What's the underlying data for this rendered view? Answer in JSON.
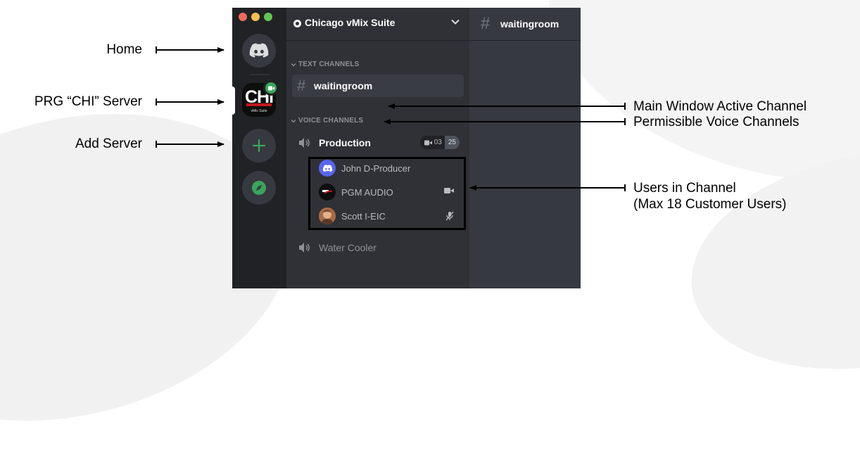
{
  "window": {
    "server_name": "Chicago vMix Suite",
    "active_channel": "waitingroom"
  },
  "server_rail": {
    "chi_logo_text": "CHi",
    "chi_logo_subtext": "vMix Suite"
  },
  "categories": {
    "text": "TEXT CHANNELS",
    "voice": "VOICE CHANNELS"
  },
  "text_channels": [
    {
      "name": "waitingroom",
      "selected": true
    }
  ],
  "voice_channels": [
    {
      "name": "Production",
      "video_count": "03",
      "user_count": "25",
      "users": [
        {
          "name": "John D-Producer",
          "avatar": "discord-avatar-icon",
          "status_icon": ""
        },
        {
          "name": "PGM AUDIO",
          "avatar": "prg-logo-avatar",
          "status_icon": "video-camera-icon"
        },
        {
          "name": "Scott I-EIC",
          "avatar": "photo-avatar",
          "status_icon": "muted-mic-icon"
        }
      ]
    },
    {
      "name": "Water Cooler"
    }
  ],
  "annotations": {
    "home": "Home",
    "prg_server": "PRG “CHI” Server",
    "add_server": "Add Server",
    "main_window": "Main Window Active Channel",
    "permissible_voice": "Permissible Voice Channels",
    "users_line1": "Users in Channel",
    "users_line2": "(Max 18 Customer Users)"
  },
  "colors": {
    "rail_bg": "#202225",
    "sidebar_bg": "#2f3136",
    "main_bg": "#36393f",
    "discord_blurple": "#5865f2",
    "online_green": "#3ba55c",
    "chi_red": "#c4161c"
  }
}
